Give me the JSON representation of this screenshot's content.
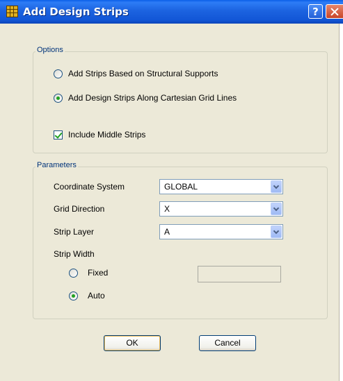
{
  "window": {
    "title": "Add Design Strips",
    "help_label": "?"
  },
  "options": {
    "legend": "Options",
    "radio_structural": {
      "label": "Add Strips Based on Structural Supports",
      "checked": false
    },
    "radio_grid": {
      "label": "Add Design Strips Along Cartesian Grid Lines",
      "checked": true
    },
    "include_middle": {
      "label": "Include Middle Strips",
      "checked": true
    }
  },
  "parameters": {
    "legend": "Parameters",
    "coordinate_system": {
      "label": "Coordinate System",
      "value": "GLOBAL"
    },
    "grid_direction": {
      "label": "Grid Direction",
      "value": "X"
    },
    "strip_layer": {
      "label": "Strip Layer",
      "value": "A"
    },
    "strip_width": {
      "label": "Strip Width",
      "fixed": {
        "label": "Fixed",
        "checked": false,
        "value": ""
      },
      "auto": {
        "label": "Auto",
        "checked": true
      }
    }
  },
  "buttons": {
    "ok": "OK",
    "cancel": "Cancel"
  },
  "icons": {
    "app": "grid-app-icon",
    "help": "help-icon",
    "close": "close-icon",
    "dropdown": "chevron-down-icon"
  }
}
